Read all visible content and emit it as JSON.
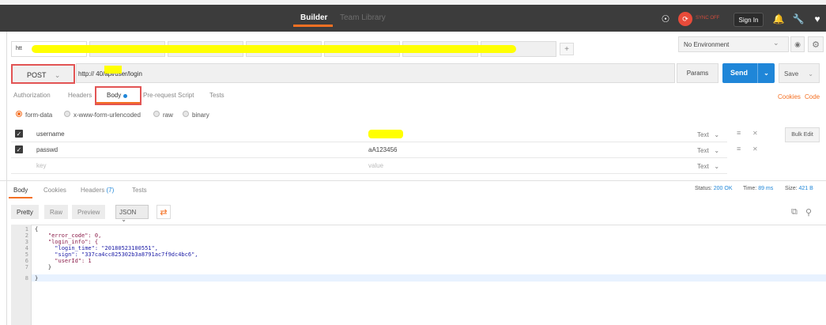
{
  "topbar": {
    "builder": "Builder",
    "team_library": "Team Library",
    "sync_label": "SYNC OFF",
    "sign_in": "Sign In"
  },
  "request_tabs": [
    {
      "label": "htt"
    },
    {
      "label": ""
    },
    {
      "label": ""
    },
    {
      "label": ""
    },
    {
      "label": ""
    },
    {
      "label": ""
    },
    {
      "label": ""
    }
  ],
  "add_tab": "+",
  "environment": {
    "selected": "No Environment"
  },
  "request": {
    "method": "POST",
    "url": "http://                40/api/user/login",
    "params": "Params",
    "send": "Send",
    "save": "Save"
  },
  "request_subtabs": {
    "authorization": "Authorization",
    "headers": "Headers",
    "body": "Body",
    "prerequest": "Pre-request Script",
    "tests": "Tests"
  },
  "links": {
    "cookies": "Cookies",
    "code": "Code"
  },
  "body_types": {
    "formdata": "form-data",
    "urlencoded": "x-www-form-urlencoded",
    "raw": "raw",
    "binary": "binary"
  },
  "form_rows": [
    {
      "key": "username",
      "value": "",
      "type": "Text"
    },
    {
      "key": "passwd",
      "value": "aA123456",
      "type": "Text"
    },
    {
      "key": "key",
      "value": "value",
      "type": "Text"
    }
  ],
  "bulk_edit": "Bulk Edit",
  "response": {
    "tabs": {
      "body": "Body",
      "cookies": "Cookies",
      "headers": "Headers",
      "headers_count": "(7)",
      "tests": "Tests"
    },
    "status_label": "Status:",
    "status": "200 OK",
    "time_label": "Time:",
    "time": "89 ms",
    "size_label": "Size:",
    "size": "421 B",
    "view": {
      "pretty": "Pretty",
      "raw": "Raw",
      "preview": "Preview",
      "format": "JSON"
    }
  },
  "code_lines": [
    "{",
    "    \"error_code\": 0,",
    "    \"login_info\": {",
    "      \"login_time\": \"20180523100551\",",
    "      \"sign\": \"337ca4cc825302b3a8791ac7f9dc4bc6\",",
    "      \"userId\": 1",
    "    }",
    "}"
  ],
  "line_numbers": [
    "1",
    "2",
    "3",
    "4",
    "5",
    "6",
    "7",
    "8"
  ]
}
